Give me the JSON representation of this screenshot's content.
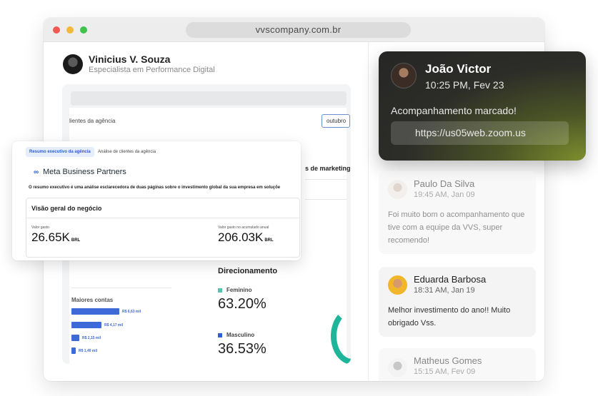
{
  "browser": {
    "url": "vvscompany.com.br"
  },
  "profile": {
    "name": "Vinicius V. Souza",
    "role": "Especialista em Performance Digital"
  },
  "dashboard": {
    "clients_label": "lientes da agência",
    "month_select": "outubro",
    "marketing_heading": "s de marketing d",
    "top_accounts_label": "Maiores contas",
    "bars": [
      {
        "label": "R$ 6,63 mil",
        "value": 6.63
      },
      {
        "label": "R$ 4,17 mil",
        "value": 4.17
      },
      {
        "label": "R$ 2,15 mil",
        "value": 2.15
      },
      {
        "label": "R$ 1,40 mil",
        "value": 1.4
      }
    ],
    "targeting_title": "Direcionamento",
    "female_label": "Feminino",
    "female_value": "63.20%",
    "male_label": "Masculino",
    "male_value": "36.53%",
    "colors": {
      "female": "#56c2b1",
      "male": "#2f5ed6",
      "accent": "#3e69d8"
    }
  },
  "exec_card": {
    "tab_active": "Resumo executivo da agência",
    "tab_inactive": "Análise de clientes da agência",
    "brand": "Meta Business Partners",
    "description": "O resumo executivo é uma análise esclarecedora de duas páginas sobre o investimento global da sua empresa em soluçõe",
    "section_title": "Visão geral do negócio",
    "spent_label": "Valor gasto",
    "spent_value": "26.65K",
    "spent_currency": "BRL",
    "annual_label": "Valor gasto no acumulado anual",
    "annual_value": "206.03K",
    "annual_currency": "BRL"
  },
  "notification": {
    "name": "João Victor",
    "time": "10:25 PM, Fev 23",
    "message": "Acompanhamento marcado!",
    "link": "https://us05web.zoom.us"
  },
  "reviews": [
    {
      "name": "Paulo Da Silva",
      "date": "19:45 AM, Jan 09",
      "text": "Foi muito bom o acompanhamento que tive com a equipe da VVS, super recomendo!"
    },
    {
      "name": "Eduarda Barbosa",
      "date": "18:31 AM, Jan 19",
      "text": "Melhor investimento do ano!! Muito obrigado Vss."
    },
    {
      "name": "Matheus Gomes",
      "date": "15:15 AM, Fev 09",
      "text": ""
    }
  ]
}
